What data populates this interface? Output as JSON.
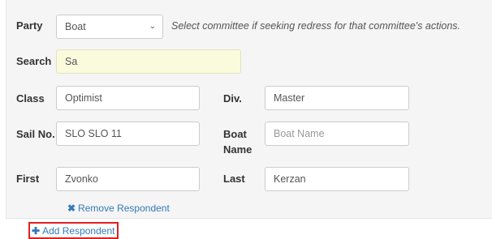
{
  "party": {
    "label": "Party",
    "selected": "Boat",
    "hint": "Select committee if seeking redress for that committee's actions."
  },
  "search": {
    "label": "Search",
    "value": "Sa"
  },
  "class_field": {
    "label": "Class",
    "value": "Optimist"
  },
  "div_field": {
    "label": "Div.",
    "value": "Master"
  },
  "sail_no": {
    "label": "Sail No.",
    "value": "SLO SLO 11"
  },
  "boat_name": {
    "label_line1": "Boat",
    "label_line2": "Name",
    "placeholder": "Boat Name",
    "value": ""
  },
  "first": {
    "label": "First",
    "value": "Zvonko"
  },
  "last": {
    "label": "Last",
    "value": "Kerzan"
  },
  "actions": {
    "remove_icon": "✖",
    "remove_label": "Remove Respondent",
    "add_icon": "✚",
    "add_label": "Add Respondent"
  },
  "colors": {
    "link": "#337ab7",
    "highlight_box": "#e02020",
    "search_bg": "#fafadc"
  }
}
